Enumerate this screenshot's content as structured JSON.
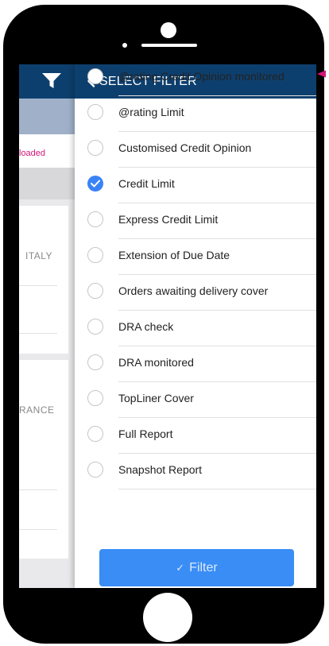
{
  "header": {
    "title": "SELECT FILTER"
  },
  "background": {
    "loaded_text": "loaded",
    "countries": [
      "ITALY",
      "RANCE"
    ]
  },
  "filters": [
    {
      "label": "@rating Credit Opinion monitored",
      "checked": false
    },
    {
      "label": "@rating Limit",
      "checked": false
    },
    {
      "label": "Customised Credit Opinion",
      "checked": false
    },
    {
      "label": "Credit Limit",
      "checked": true
    },
    {
      "label": "Express Credit Limit",
      "checked": false
    },
    {
      "label": "Extension of Due Date",
      "checked": false
    },
    {
      "label": "Orders awaiting delivery cover",
      "checked": false
    },
    {
      "label": "DRA check",
      "checked": false
    },
    {
      "label": "DRA monitored",
      "checked": false
    },
    {
      "label": "TopLiner Cover",
      "checked": false
    },
    {
      "label": "Full Report",
      "checked": false
    },
    {
      "label": "Snapshot Report",
      "checked": false
    }
  ],
  "filter_button": {
    "label": "Filter",
    "check_glyph": "✓"
  },
  "colors": {
    "header_bg": "#0d3f6e",
    "accent": "#3a82f7",
    "button_bg": "#3a8df5",
    "magenta": "#d3177a"
  },
  "icons": [
    "funnel-icon",
    "chevron-left-icon",
    "checkmark-icon",
    "magenta-arrow-icon"
  ]
}
